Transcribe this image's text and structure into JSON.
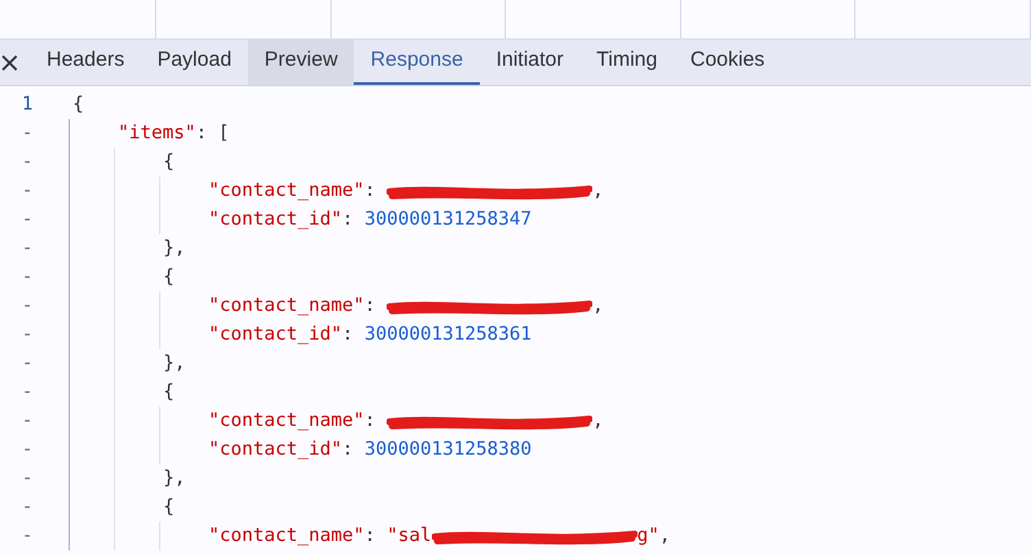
{
  "tabs": [
    {
      "label": "Headers",
      "selected": false,
      "hovered": false
    },
    {
      "label": "Payload",
      "selected": false,
      "hovered": false
    },
    {
      "label": "Preview",
      "selected": false,
      "hovered": true
    },
    {
      "label": "Response",
      "selected": true,
      "hovered": false
    },
    {
      "label": "Initiator",
      "selected": false,
      "hovered": false
    },
    {
      "label": "Timing",
      "selected": false,
      "hovered": false
    },
    {
      "label": "Cookies",
      "selected": false,
      "hovered": false
    }
  ],
  "lines": [
    {
      "gutter": "1",
      "tokens": [
        {
          "kind": "punct",
          "text": "{"
        }
      ],
      "children": [
        {
          "gutter": "-",
          "tokens": [
            {
              "kind": "key",
              "text": "\"items\""
            },
            {
              "kind": "punct",
              "text": ": ["
            }
          ],
          "children": [
            {
              "gutter": "-",
              "tokens": [
                {
                  "kind": "punct",
                  "text": "{"
                }
              ],
              "children": [
                {
                  "gutter": "-",
                  "tokens": [
                    {
                      "kind": "key",
                      "text": "\"contact_name\""
                    },
                    {
                      "kind": "punct",
                      "text": ": "
                    },
                    {
                      "kind": "redacted"
                    },
                    {
                      "kind": "punct",
                      "text": ","
                    }
                  ]
                },
                {
                  "gutter": "-",
                  "tokens": [
                    {
                      "kind": "key",
                      "text": "\"contact_id\""
                    },
                    {
                      "kind": "punct",
                      "text": ": "
                    },
                    {
                      "kind": "number",
                      "text": "300000131258347"
                    }
                  ]
                }
              ]
            },
            {
              "gutter": "-",
              "tokens": [
                {
                  "kind": "punct",
                  "text": "},"
                }
              ]
            },
            {
              "gutter": "-",
              "tokens": [
                {
                  "kind": "punct",
                  "text": "{"
                }
              ],
              "children": [
                {
                  "gutter": "-",
                  "tokens": [
                    {
                      "kind": "key",
                      "text": "\"contact_name\""
                    },
                    {
                      "kind": "punct",
                      "text": ": "
                    },
                    {
                      "kind": "redacted"
                    },
                    {
                      "kind": "punct",
                      "text": ","
                    }
                  ]
                },
                {
                  "gutter": "-",
                  "tokens": [
                    {
                      "kind": "key",
                      "text": "\"contact_id\""
                    },
                    {
                      "kind": "punct",
                      "text": ": "
                    },
                    {
                      "kind": "number",
                      "text": "300000131258361"
                    }
                  ]
                }
              ]
            },
            {
              "gutter": "-",
              "tokens": [
                {
                  "kind": "punct",
                  "text": "},"
                }
              ]
            },
            {
              "gutter": "-",
              "tokens": [
                {
                  "kind": "punct",
                  "text": "{"
                }
              ],
              "children": [
                {
                  "gutter": "-",
                  "tokens": [
                    {
                      "kind": "key",
                      "text": "\"contact_name\""
                    },
                    {
                      "kind": "punct",
                      "text": ": "
                    },
                    {
                      "kind": "redacted"
                    },
                    {
                      "kind": "punct",
                      "text": ","
                    }
                  ]
                },
                {
                  "gutter": "-",
                  "tokens": [
                    {
                      "kind": "key",
                      "text": "\"contact_id\""
                    },
                    {
                      "kind": "punct",
                      "text": ": "
                    },
                    {
                      "kind": "number",
                      "text": "300000131258380"
                    }
                  ]
                }
              ]
            },
            {
              "gutter": "-",
              "tokens": [
                {
                  "kind": "punct",
                  "text": "},"
                }
              ]
            },
            {
              "gutter": "-",
              "tokens": [
                {
                  "kind": "punct",
                  "text": "{"
                }
              ],
              "children": [
                {
                  "gutter": "-",
                  "tokens": [
                    {
                      "kind": "key",
                      "text": "\"contact_name\""
                    },
                    {
                      "kind": "punct",
                      "text": ": "
                    },
                    {
                      "kind": "string",
                      "text": "\"sal"
                    },
                    {
                      "kind": "redacted"
                    },
                    {
                      "kind": "string",
                      "text": "g\""
                    },
                    {
                      "kind": "punct",
                      "text": ","
                    }
                  ]
                }
              ]
            }
          ]
        }
      ]
    }
  ]
}
